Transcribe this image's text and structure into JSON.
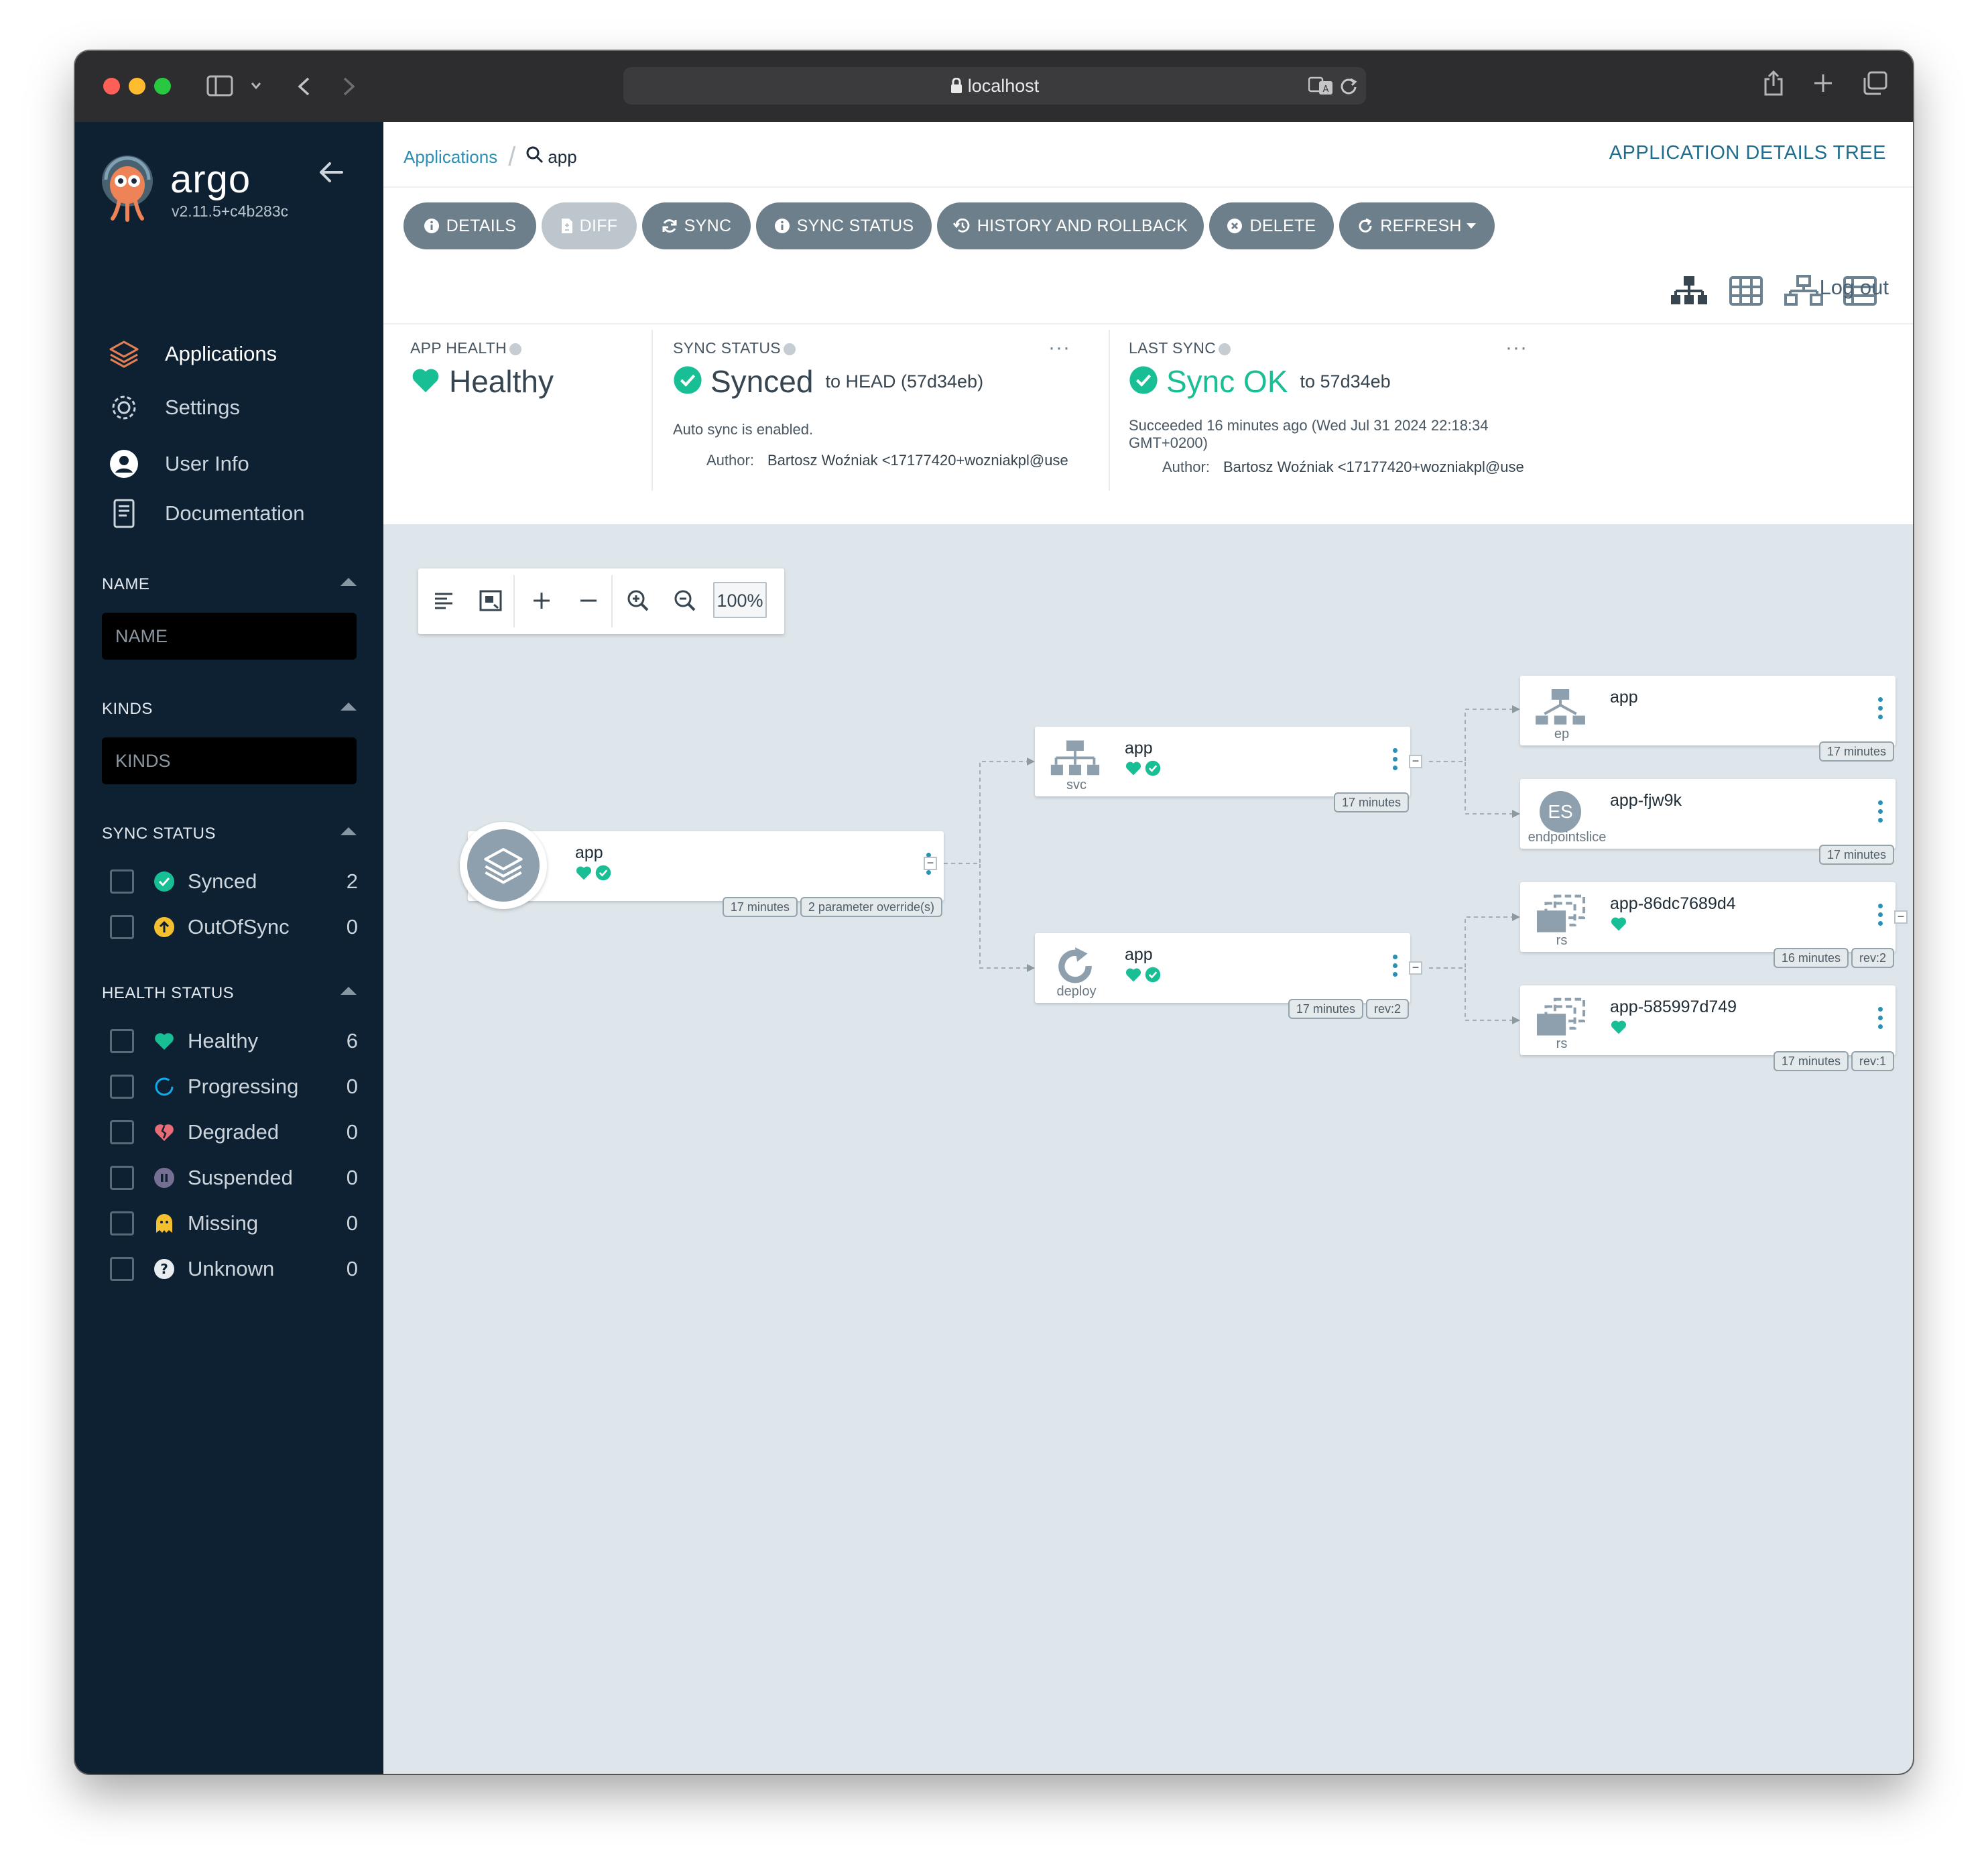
{
  "browser": {
    "url": "localhost"
  },
  "sidebar": {
    "brand": "argo",
    "version": "v2.11.5+c4b283c",
    "nav": [
      {
        "label": "Applications",
        "icon": "layers-icon",
        "active": true
      },
      {
        "label": "Settings",
        "icon": "gear-icon",
        "active": false
      },
      {
        "label": "User Info",
        "icon": "user-circle-icon",
        "active": false
      },
      {
        "label": "Documentation",
        "icon": "book-icon",
        "active": false
      }
    ],
    "name_filter": {
      "heading": "NAME",
      "placeholder": "NAME"
    },
    "kinds_filter": {
      "heading": "KINDS",
      "placeholder": "KINDS"
    },
    "sync_status": {
      "heading": "SYNC STATUS",
      "items": [
        {
          "label": "Synced",
          "count": "2",
          "icon": "synced-check-icon"
        },
        {
          "label": "OutOfSync",
          "count": "0",
          "icon": "out-of-sync-icon"
        }
      ]
    },
    "health_status": {
      "heading": "HEALTH STATUS",
      "items": [
        {
          "label": "Healthy",
          "count": "6",
          "icon": "heart-icon"
        },
        {
          "label": "Progressing",
          "count": "0",
          "icon": "spinner-icon"
        },
        {
          "label": "Degraded",
          "count": "0",
          "icon": "broken-heart-icon"
        },
        {
          "label": "Suspended",
          "count": "0",
          "icon": "pause-icon"
        },
        {
          "label": "Missing",
          "count": "0",
          "icon": "ghost-icon"
        },
        {
          "label": "Unknown",
          "count": "0",
          "icon": "question-icon"
        }
      ]
    }
  },
  "header": {
    "breadcrumb_root": "Applications",
    "breadcrumb_current": "app",
    "title": "APPLICATION DETAILS TREE",
    "logout": "Log out"
  },
  "toolbar": {
    "details": "DETAILS",
    "diff": "DIFF",
    "sync": "SYNC",
    "sync_status": "SYNC STATUS",
    "history": "HISTORY AND ROLLBACK",
    "delete": "DELETE",
    "refresh": "REFRESH"
  },
  "status": {
    "app_health": {
      "heading": "APP HEALTH",
      "value": "Healthy"
    },
    "sync_status": {
      "heading": "SYNC STATUS",
      "value": "Synced",
      "target": "to HEAD (57d34eb)",
      "note": "Auto sync is enabled.",
      "author_label": "Author:",
      "author": "Bartosz Woźniak <17177420+wozniakpl@use"
    },
    "last_sync": {
      "heading": "LAST SYNC",
      "value": "Sync OK",
      "target": "to 57d34eb",
      "line1": "Succeeded 16 minutes ago (Wed Jul 31 2024 22:18:34",
      "line2": "GMT+0200)",
      "author_label": "Author:",
      "author": "Bartosz Woźniak <17177420+wozniakpl@use"
    }
  },
  "graph": {
    "zoom": "100%",
    "nodes": {
      "root": {
        "name": "app",
        "tags": [
          "17 minutes",
          "2 parameter override(s)"
        ]
      },
      "svc": {
        "name": "app",
        "kind": "svc",
        "tags": [
          "17 minutes"
        ]
      },
      "deploy": {
        "name": "app",
        "kind": "deploy",
        "tags": [
          "17 minutes",
          "rev:2"
        ]
      },
      "ep": {
        "name": "app",
        "kind": "ep",
        "tags": [
          "17 minutes"
        ]
      },
      "es": {
        "name": "app-fjw9k",
        "kind": "endpointslice",
        "badge": "ES",
        "tags": [
          "17 minutes"
        ]
      },
      "rs1": {
        "name": "app-86dc7689d4",
        "kind": "rs",
        "tags": [
          "16 minutes",
          "rev:2"
        ]
      },
      "rs2": {
        "name": "app-585997d749",
        "kind": "rs",
        "tags": [
          "17 minutes",
          "rev:1"
        ]
      }
    }
  },
  "colors": {
    "healthy": "#18be94",
    "outofsync": "#f4c030",
    "degraded": "#e96d76",
    "suspended": "#766f94",
    "progressing": "#0dadea",
    "sidebar_bg": "#0e2133",
    "accent": "#2c8fb4"
  }
}
